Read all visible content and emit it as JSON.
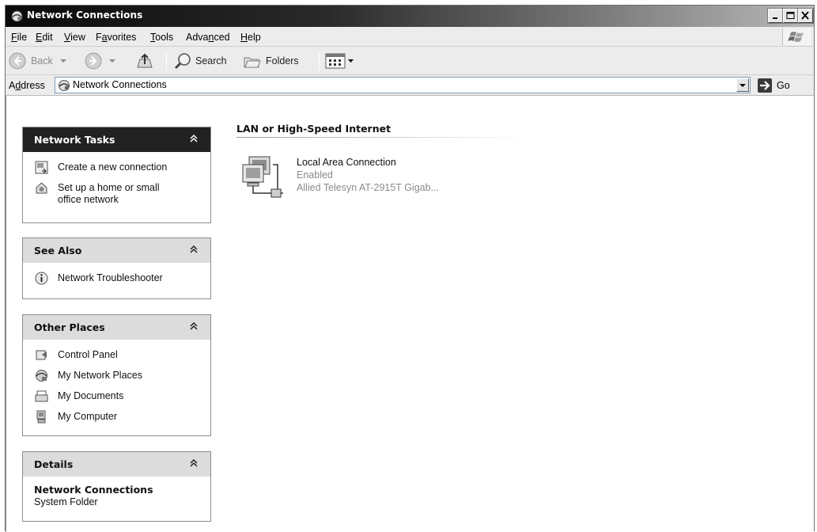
{
  "window": {
    "title": "Network Connections"
  },
  "menu": [
    {
      "label": "File",
      "underline": "F",
      "rest": "ile"
    },
    {
      "label": "Edit",
      "underline": "E",
      "rest": "dit"
    },
    {
      "label": "View",
      "underline": "V",
      "rest": "iew"
    },
    {
      "label": "Favorites",
      "pre": "F",
      "underline": "a",
      "rest": "vorites"
    },
    {
      "label": "Tools",
      "underline": "T",
      "rest": "ools"
    },
    {
      "label": "Advanced",
      "pre": "Adva",
      "underline": "n",
      "rest": "ced"
    },
    {
      "label": "Help",
      "underline": "H",
      "rest": "elp"
    }
  ],
  "toolbar": {
    "back_label": "Back",
    "search_label": "Search",
    "folders_label": "Folders"
  },
  "address": {
    "label_pre": "A",
    "label_underline": "d",
    "label_rest": "dress",
    "value": "Network Connections",
    "go_label": "Go"
  },
  "network_tasks": {
    "title": "Network Tasks",
    "items": [
      {
        "label": "Create a new connection",
        "icon": "new-connection-icon"
      },
      {
        "label_line1": "Set up a home or small",
        "label_line2": "office network",
        "icon": "home-network-wizard-icon"
      }
    ]
  },
  "see_also": {
    "title": "See Also",
    "items": [
      {
        "label": "Network Troubleshooter",
        "icon": "info-icon"
      }
    ]
  },
  "other_places": {
    "title": "Other Places",
    "items": [
      {
        "label": "Control Panel",
        "icon": "control-panel-icon"
      },
      {
        "label": "My Network Places",
        "icon": "network-places-icon"
      },
      {
        "label": "My Documents",
        "icon": "documents-icon"
      },
      {
        "label": "My Computer",
        "icon": "computer-icon"
      }
    ]
  },
  "details": {
    "title": "Details",
    "name": "Network Connections",
    "type": "System Folder"
  },
  "content": {
    "group_header": "LAN or High-Speed Internet",
    "connections": [
      {
        "name": "Local Area Connection",
        "status": "Enabled",
        "device": "Allied Telesyn AT-2915T Gigab..."
      }
    ]
  }
}
